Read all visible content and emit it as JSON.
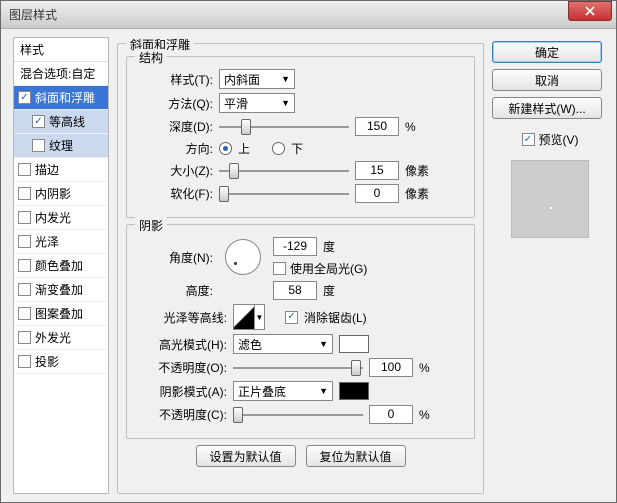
{
  "title": "图层样式",
  "left": {
    "header": "样式",
    "blendOpt": "混合选项:自定",
    "items": [
      {
        "label": "斜面和浮雕",
        "chk": true,
        "sel": true
      },
      {
        "label": "等高线",
        "chk": true,
        "sub": true,
        "sel2": true
      },
      {
        "label": "纹理",
        "chk": false,
        "sub": true,
        "sel2": true
      },
      {
        "label": "描边",
        "chk": false
      },
      {
        "label": "内阴影",
        "chk": false
      },
      {
        "label": "内发光",
        "chk": false
      },
      {
        "label": "光泽",
        "chk": false
      },
      {
        "label": "颜色叠加",
        "chk": false
      },
      {
        "label": "渐变叠加",
        "chk": false
      },
      {
        "label": "图案叠加",
        "chk": false
      },
      {
        "label": "外发光",
        "chk": false
      },
      {
        "label": "投影",
        "chk": false
      }
    ]
  },
  "bevel": {
    "grpTitle": "斜面和浮雕",
    "structTitle": "结构",
    "styleLbl": "样式(T):",
    "styleVal": "内斜面",
    "techLbl": "方法(Q):",
    "techVal": "平滑",
    "depthLbl": "深度(D):",
    "depthVal": "150",
    "pct": "%",
    "dirLbl": "方向:",
    "up": "上",
    "down": "下",
    "sizeLbl": "大小(Z):",
    "sizeVal": "15",
    "px": "像素",
    "softLbl": "软化(F):",
    "softVal": "0",
    "shadeTitle": "阴影",
    "angleLbl": "角度(N):",
    "angleVal": "-129",
    "deg": "度",
    "globalLbl": "使用全局光(G)",
    "altLbl": "高度:",
    "altVal": "58",
    "glossLbl": "光泽等高线:",
    "aaLbl": "消除锯齿(L)",
    "hiLbl": "高光模式(H):",
    "hiVal": "滤色",
    "hiOpLbl": "不透明度(O):",
    "hiOpVal": "100",
    "shLbl": "阴影模式(A):",
    "shVal": "正片叠底",
    "shOpLbl": "不透明度(C):",
    "shOpVal": "0",
    "defBtn": "设置为默认值",
    "resetBtn": "复位为默认值"
  },
  "right": {
    "ok": "确定",
    "cancel": "取消",
    "newStyle": "新建样式(W)...",
    "preview": "预览(V)"
  },
  "chart_data": null
}
